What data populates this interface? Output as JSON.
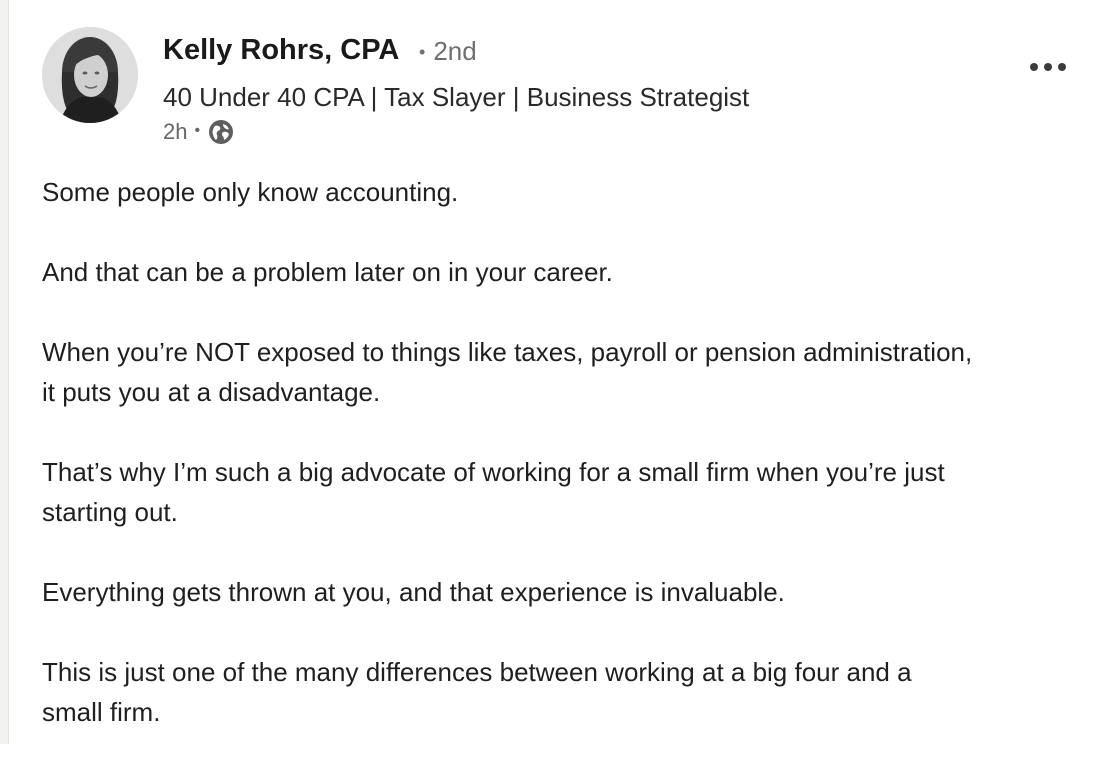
{
  "post": {
    "author": {
      "name": "Kelly Rohrs, CPA",
      "degree": "2nd",
      "headline": "40 Under 40 CPA | Tax Slayer | Business Strategist",
      "time": "2h",
      "visibility_icon": "globe-icon"
    },
    "menu_icon": "more-icon",
    "paragraphs": [
      "Some people only know accounting.",
      "And that can be a problem later on in your career.",
      "When you’re NOT exposed to things like taxes, payroll or pension administration,\nit puts you at a disadvantage.",
      "That’s why I’m such a big advocate of working for a small firm when you’re just\nstarting out.",
      "Everything gets thrown at you, and that experience is invaluable.",
      "This is just one of the many differences between working at a big four and a\nsmall firm."
    ]
  },
  "colors": {
    "text": "#1f1f1f",
    "secondary_text": "#666666",
    "background": "#ffffff"
  }
}
